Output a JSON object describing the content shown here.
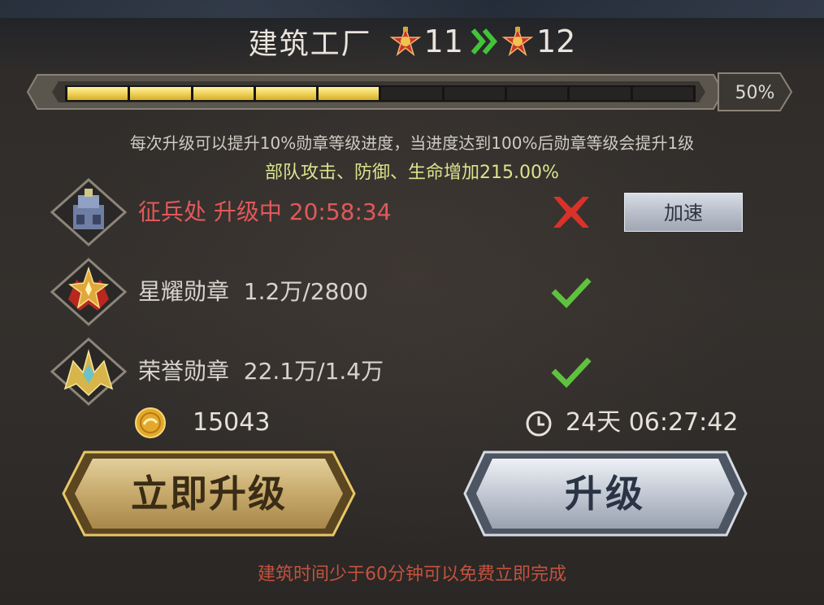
{
  "header": {
    "title": "建筑工厂",
    "current_level": "11",
    "next_level": "12",
    "medal_icon": "red-star-medal-icon",
    "arrow_icon": "double-chevron-right-icon",
    "arrow_color": "#43c23a"
  },
  "progress": {
    "value": 0.5,
    "segments_total": 10,
    "segments_filled": 5,
    "label": "50%",
    "fill_color": "#f0d35a"
  },
  "description": {
    "line1": "每次升级可以提升10%勋章等级进度，当进度达到100%后勋章等级会提升1级",
    "line2": "部队攻击、防御、生命增加215.00%"
  },
  "requirements": [
    {
      "icon": "barracks-building-icon",
      "label": "征兵处 升级中 20:58:34",
      "status": "failed",
      "status_icon": "red-x-icon",
      "action_label": "加速"
    },
    {
      "icon": "star-medal-icon",
      "label": "星耀勋章  1.2万/2800",
      "status": "met",
      "status_icon": "green-check-icon"
    },
    {
      "icon": "honor-medal-icon",
      "label": "荣誉勋章  22.1万/1.4万",
      "status": "met",
      "status_icon": "green-check-icon"
    }
  ],
  "cost": {
    "icon": "gold-coin-icon",
    "value": "15043"
  },
  "time": {
    "icon": "clock-icon",
    "value": "24天 06:27:42"
  },
  "buttons": {
    "instant_upgrade": "立即升级",
    "upgrade": "升级"
  },
  "footnote": "建筑时间少于60分钟可以免费立即完成",
  "colors": {
    "warning_red": "#e1595a",
    "bonus_green": "#d8e48c",
    "gold_button": "#c9b078",
    "silver_button": "#c6ccd6"
  }
}
